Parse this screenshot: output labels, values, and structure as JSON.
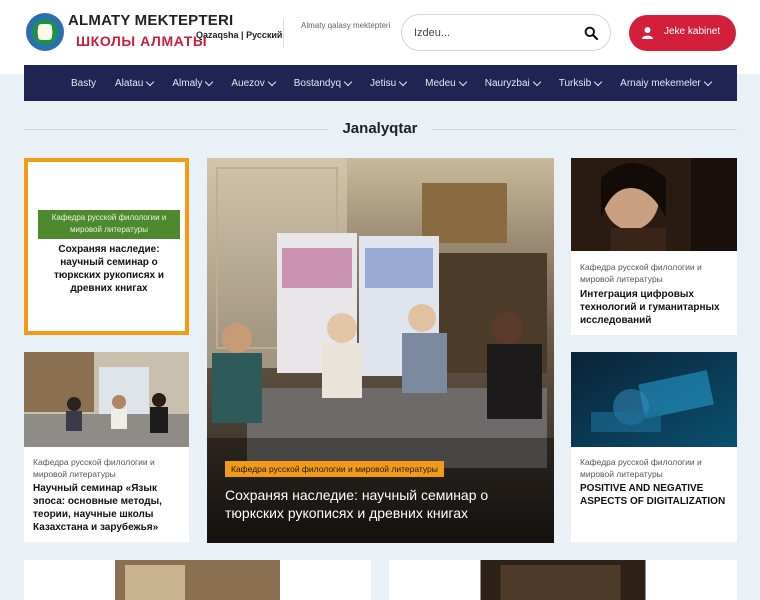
{
  "header": {
    "brand_top": "ALMATY MEKTEPTERI",
    "brand_bottom": "ШКОЛЫ АЛМАТЫ",
    "lang_kz": "Qazaqsha",
    "lang_sep": "|",
    "lang_ru": "Русский",
    "subtitle": "Almaty qalasy mektepteri",
    "search_placeholder": "Izdeu...",
    "cabinet_label": "Jeke kabinet"
  },
  "nav": {
    "items": [
      {
        "label": "Basty",
        "dropdown": false
      },
      {
        "label": "Alatau",
        "dropdown": true
      },
      {
        "label": "Almaly",
        "dropdown": true
      },
      {
        "label": "Auezov",
        "dropdown": true
      },
      {
        "label": "Bostandyq",
        "dropdown": true
      },
      {
        "label": "Jetisu",
        "dropdown": true
      },
      {
        "label": "Medeu",
        "dropdown": true
      },
      {
        "label": "Nauryzbai",
        "dropdown": true
      },
      {
        "label": "Turksib",
        "dropdown": true
      },
      {
        "label": "Arnaiy mekemeler",
        "dropdown": true
      }
    ]
  },
  "section": {
    "title": "Janalyqtar"
  },
  "cards": {
    "highlight": {
      "category": "Кафедра русской филологии и мировой литературы",
      "title": "Сохраняя наследие: научный семинар о тюркских рукописях и древних книгах"
    },
    "featured": {
      "category": "Кафедра русской филологии и мировой литературы",
      "title": "Сохраняя наследие: научный семинар о тюркских рукописях и древних книгах"
    },
    "top_right": {
      "category": "Кафедра русской филологии и мировой литературы",
      "title": "Интеграция цифровых технологий и гуманитарных исследований"
    },
    "mid_left": {
      "category": "Кафедра русской филологии и мировой литературы",
      "title": "Научный семинар «Язык эпоса: основные методы, теории, научные школы Казахстана и зарубежья»"
    },
    "mid_right": {
      "category": "Кафедра русской филологии и мировой литературы",
      "title": "POSITIVE AND NEGATIVE ASPECTS OF DIGITALIZATION"
    }
  },
  "colors": {
    "nav_bg": "#1f2452",
    "accent_red": "#d31f3c",
    "accent_orange": "#f39a18",
    "badge_green": "#4d8a2e"
  }
}
